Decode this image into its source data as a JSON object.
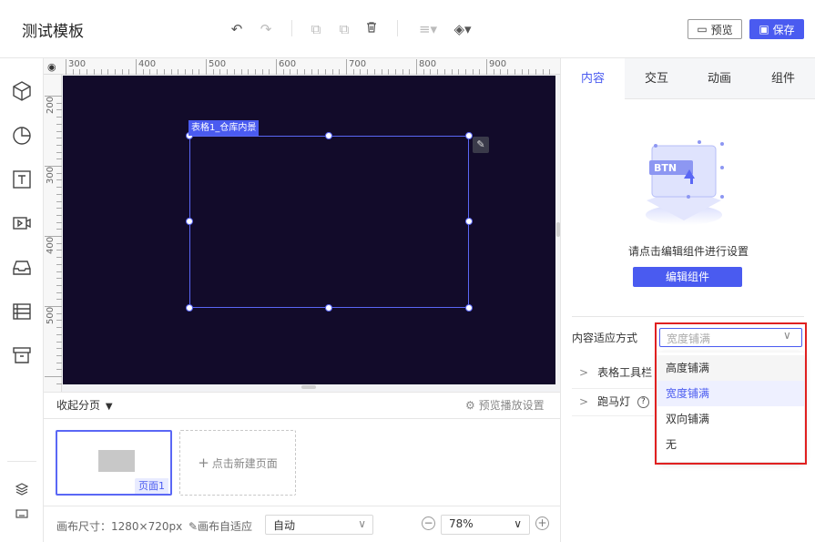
{
  "header": {
    "title": "测试模板",
    "toolbar": {
      "undo_icon": "undo-icon",
      "redo_icon": "redo-icon",
      "copy_icon": "copy-icon",
      "paste_icon": "paste-icon",
      "delete_icon": "trash-icon",
      "align_icon": "align-icon",
      "layer_icon": "layer-icon"
    },
    "preview_label": "预览",
    "save_label": "保存"
  },
  "left_rail": {
    "items": [
      "cube-icon",
      "pie-chart-icon",
      "text-icon",
      "video-icon",
      "inbox-icon",
      "table-icon",
      "archive-icon"
    ],
    "bottom_items": [
      "layers-icon",
      "keyboard-icon"
    ]
  },
  "canvas": {
    "ruler_top_labels": [
      "300",
      "400",
      "500",
      "600",
      "700",
      "800",
      "900"
    ],
    "ruler_left_labels": [
      "200",
      "300",
      "400",
      "500"
    ],
    "component_tag": "表格1_仓库内景",
    "background_color": "#120b2a",
    "selection_color": "#5a67f5"
  },
  "pages": {
    "collapse_label": "收起分页",
    "preview_settings": "预览播放设置",
    "page_label": "页面1",
    "new_page_label": "点击新建页面"
  },
  "bottom_bar": {
    "canvas_size": "画布尺寸：1280×720px",
    "adapt_label": "画布自适应",
    "adapt_value": "自动",
    "zoom_value": "78%"
  },
  "right_panel": {
    "tabs": [
      "内容",
      "交互",
      "动画",
      "组件"
    ],
    "active_tab": "内容",
    "illustration_text": "BTN",
    "hint": "请点击编辑组件进行设置",
    "edit_button": "编辑组件",
    "content_adapt_label": "内容适应方式",
    "dropdown_placeholder": "宽度铺满",
    "rows": [
      "表格工具栏",
      "跑马灯"
    ],
    "dropdown_options": [
      "高度铺满",
      "宽度铺满",
      "双向铺满",
      "无"
    ],
    "selected_option": "宽度铺满",
    "accent": "#4a5bf0",
    "highlight": "#e02020"
  }
}
